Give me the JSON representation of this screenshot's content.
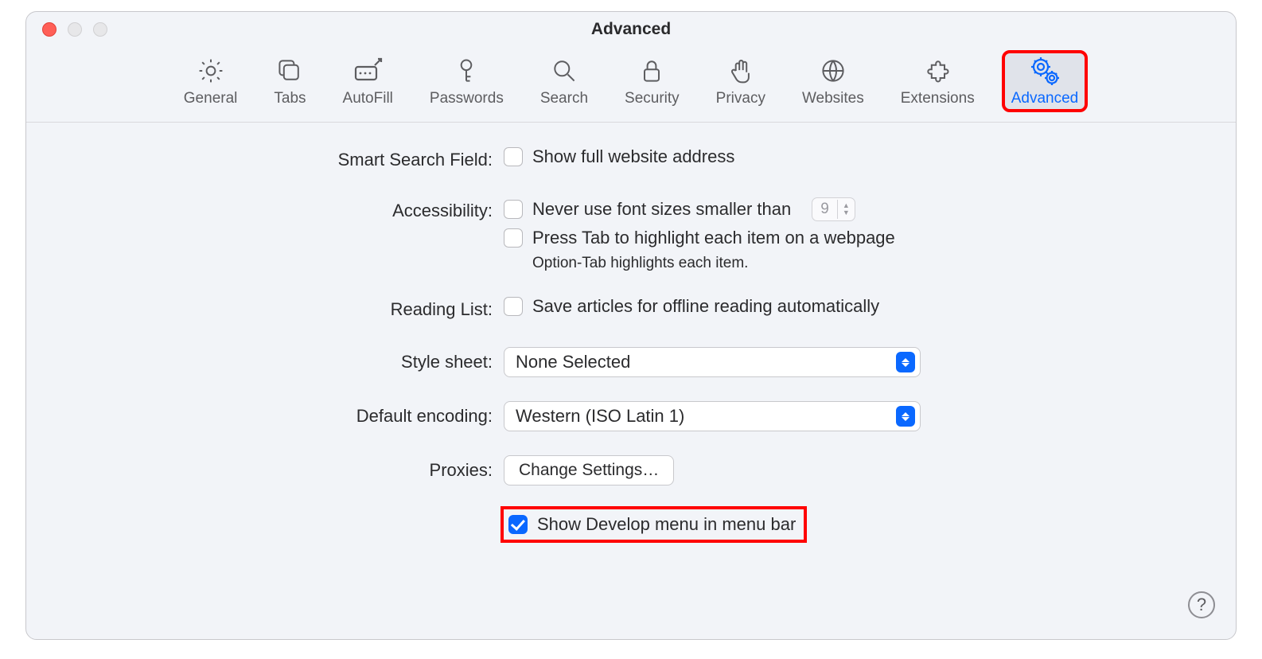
{
  "window": {
    "title": "Advanced"
  },
  "tabs": {
    "general": "General",
    "tabs": "Tabs",
    "autofill": "AutoFill",
    "passwords": "Passwords",
    "search": "Search",
    "security": "Security",
    "privacy": "Privacy",
    "websites": "Websites",
    "extensions": "Extensions",
    "advanced": "Advanced"
  },
  "labels": {
    "smart_search": "Smart Search Field:",
    "accessibility": "Accessibility:",
    "reading_list": "Reading List:",
    "style_sheet": "Style sheet:",
    "default_encoding": "Default encoding:",
    "proxies": "Proxies:"
  },
  "options": {
    "show_full_address": "Show full website address",
    "never_font_smaller": "Never use font sizes smaller than",
    "font_size_value": "9",
    "press_tab": "Press Tab to highlight each item on a webpage",
    "option_tab_hint": "Option-Tab highlights each item.",
    "save_offline": "Save articles for offline reading automatically",
    "style_sheet_value": "None Selected",
    "encoding_value": "Western (ISO Latin 1)",
    "change_settings": "Change Settings…",
    "develop_menu": "Show Develop menu in menu bar"
  },
  "help_glyph": "?"
}
